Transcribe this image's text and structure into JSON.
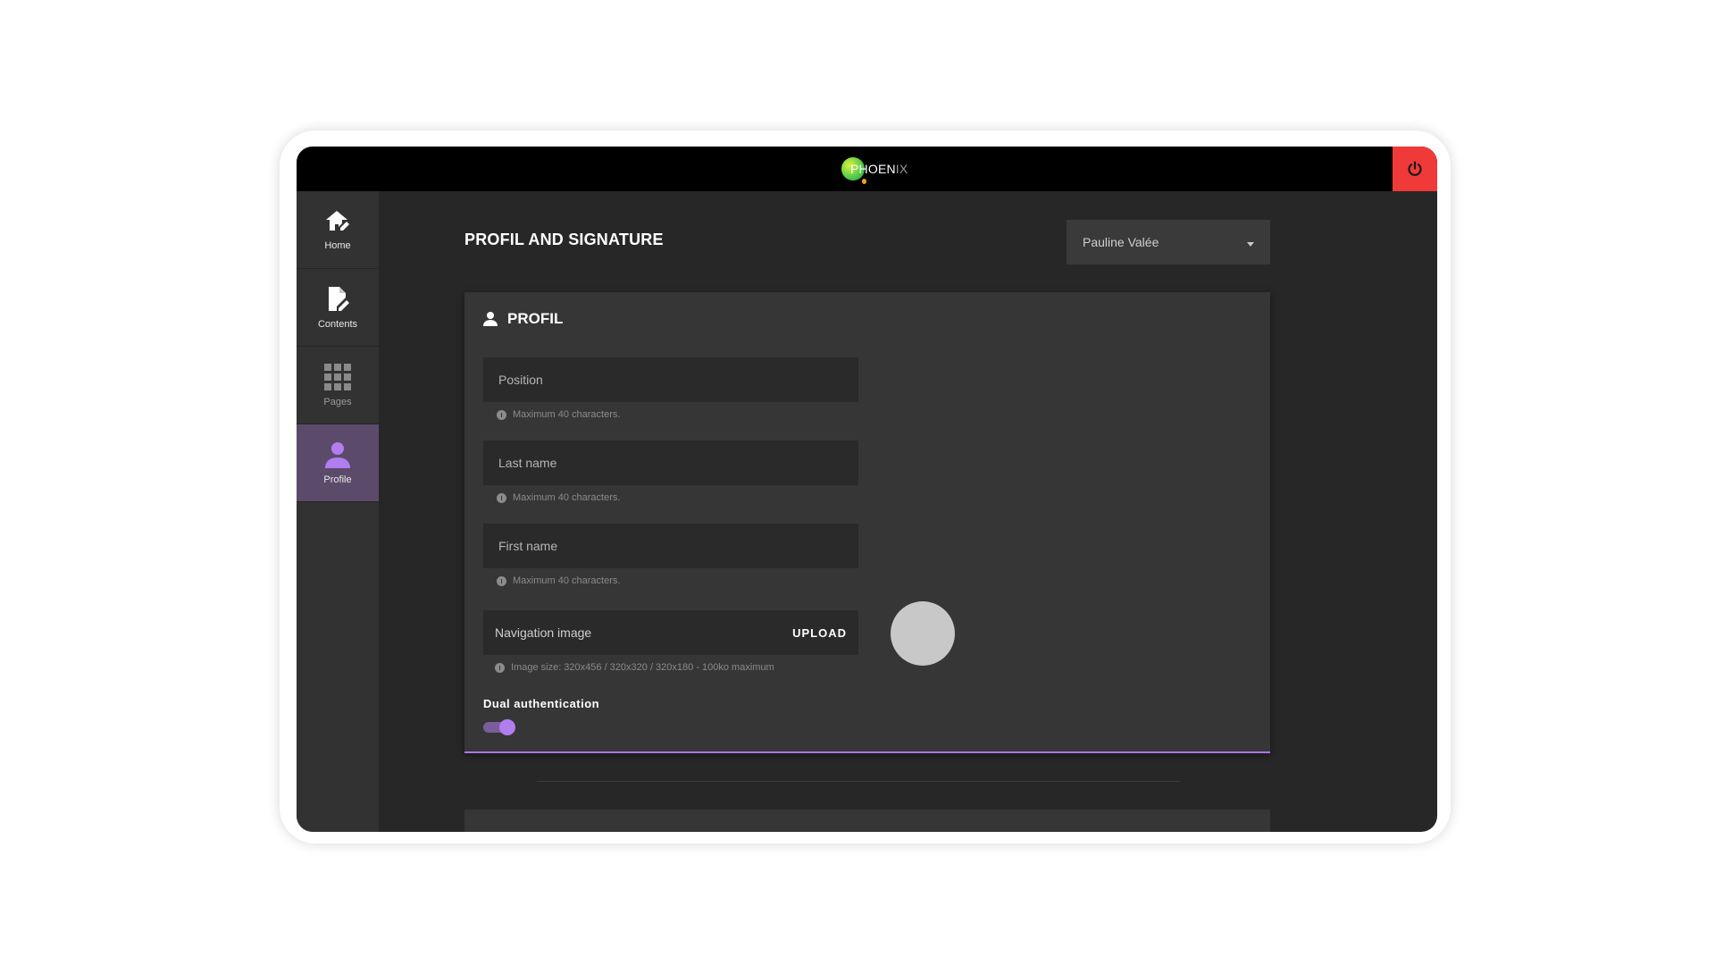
{
  "app": {
    "logo_text_bright": "PHOEN",
    "logo_text_dim": "IX"
  },
  "sidebar": {
    "items": [
      {
        "label": "Home",
        "icon": "home-edit-icon"
      },
      {
        "label": "Contents",
        "icon": "document-edit-icon"
      },
      {
        "label": "Pages",
        "icon": "grid-icon"
      },
      {
        "label": "Profile",
        "icon": "person-icon"
      }
    ]
  },
  "header": {
    "title": "PROFIL AND SIGNATURE",
    "user_select_value": "Pauline Valée"
  },
  "profile": {
    "title": "PROFIL",
    "position_placeholder": "Position",
    "position_hint": "Maximum 40 characters.",
    "last_name_placeholder": "Last name",
    "last_name_hint": "Maximum 40 characters.",
    "first_name_placeholder": "First name",
    "first_name_hint": "Maximum 40 characters.",
    "nav_image_label": "Navigation image",
    "upload_label": "UPLOAD",
    "nav_image_hint": "Image size: 320x456 / 320x320 / 320x180 - 100ko maximum",
    "dual_auth_label": "Dual authentication",
    "dual_auth_enabled": true
  },
  "colors": {
    "accent": "#b17ef0",
    "power": "#f03a3a",
    "active_nav": "#5b4a6a"
  }
}
